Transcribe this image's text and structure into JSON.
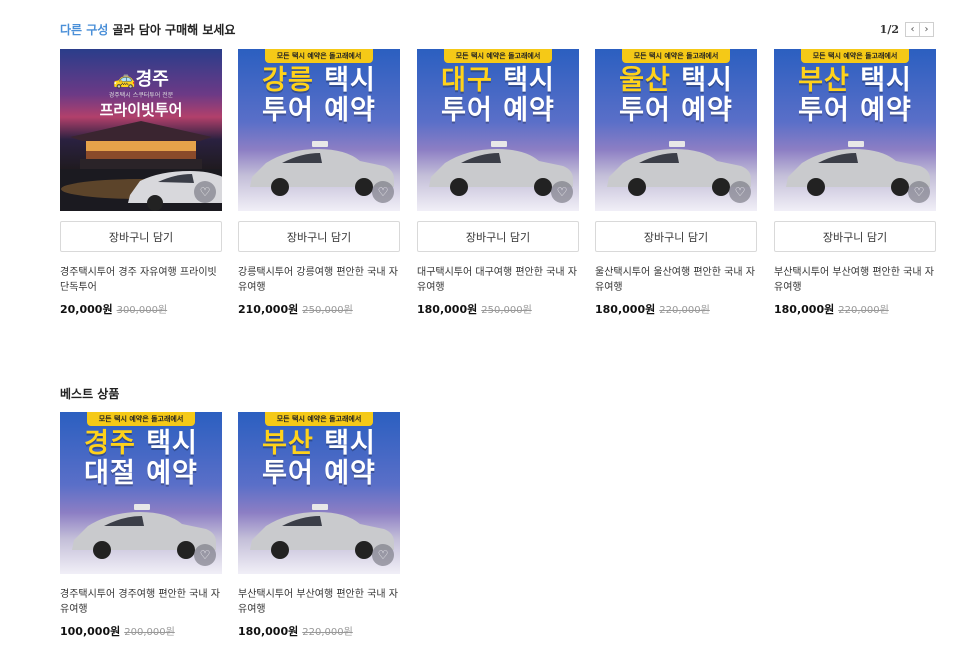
{
  "section1": {
    "title_accent": "다른 구성",
    "title_rest": " 골라 담아 구매해 보세요",
    "pager": "1/2",
    "pager_prev_icon": "chevron-left-icon",
    "pager_next_icon": "chevron-right-icon",
    "cart_label": "장바구니 담기",
    "products": [
      {
        "name": "경주택시투어 경주 자유여행 프라이빗 단독투어",
        "price": "20,000원",
        "original": "300,000원",
        "image": {
          "variant": "gyeongju-private",
          "title_prefix": "🚕",
          "title": "경주",
          "sub": "경주택시 스쿠터투어 전문",
          "sub2": "프라이빗투어"
        }
      },
      {
        "name": "강릉택시투어 강릉여행 편안한 국내 자유여행",
        "price": "210,000원",
        "original": "250,000원",
        "image": {
          "banner": "모든 택시 예약은 돌고래에서",
          "city": "강릉",
          "word1": "택시",
          "line2": "투어 예약"
        }
      },
      {
        "name": "대구택시투어 대구여행 편안한 국내 자유여행",
        "price": "180,000원",
        "original": "250,000원",
        "image": {
          "banner": "모든 택시 예약은 돌고래에서",
          "city": "대구",
          "word1": "택시",
          "line2": "투어 예약"
        }
      },
      {
        "name": "울산택시투어 울산여행 편안한 국내 자유여행",
        "price": "180,000원",
        "original": "220,000원",
        "image": {
          "banner": "모든 택시 예약은 돌고래에서",
          "city": "울산",
          "word1": "택시",
          "line2": "투어 예약"
        }
      },
      {
        "name": "부산택시투어 부산여행 편안한 국내 자유여행",
        "price": "180,000원",
        "original": "220,000원",
        "image": {
          "banner": "모든 택시 예약은 돌고래에서",
          "city": "부산",
          "word1": "택시",
          "line2": "투어 예약"
        }
      }
    ]
  },
  "section2": {
    "title": "베스트 상품",
    "products": [
      {
        "name": "경주택시투어 경주여행 편안한 국내 자유여행",
        "price": "100,000원",
        "original": "200,000원",
        "image": {
          "banner": "모든 택시 예약은 돌고래에서",
          "city": "경주",
          "word1": "택시",
          "line2": "대절 예약"
        }
      },
      {
        "name": "부산택시투어 부산여행 편안한 국내 자유여행",
        "price": "180,000원",
        "original": "220,000원",
        "image": {
          "banner": "모든 택시 예약은 돌고래에서",
          "city": "부산",
          "word1": "택시",
          "line2": "투어 예약"
        }
      }
    ]
  },
  "icons": {
    "wishlist": "heart-icon",
    "car": "car-image"
  },
  "colors": {
    "accent": "#4a8fd8",
    "banner_yellow": "#f5c917",
    "city_yellow": "#ffd21a"
  }
}
